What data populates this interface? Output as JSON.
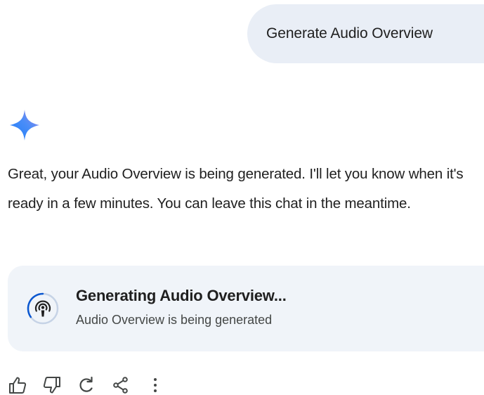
{
  "user_message": {
    "text": "Generate Audio Overview"
  },
  "assistant": {
    "icon": "gemini-sparkle-icon",
    "response_text": "Great, your Audio Overview is being generated. I'll let you know when it's ready in a few minutes. You can leave this chat in the meantime.",
    "status_card": {
      "icon": "podcast-generating-icon",
      "title": "Generating Audio Overview...",
      "subtitle": "Audio Overview is being generated"
    },
    "actions": [
      {
        "icon": "thumbs-up-icon"
      },
      {
        "icon": "thumbs-down-icon"
      },
      {
        "icon": "redo-icon"
      },
      {
        "icon": "share-icon"
      },
      {
        "icon": "more-options-icon"
      }
    ]
  },
  "colors": {
    "user_bubble": "#e9eef6",
    "card_background": "#f0f4f9",
    "accent_blue": "#0b57d0",
    "text_primary": "#1f1f1f",
    "text_secondary": "#444746"
  }
}
